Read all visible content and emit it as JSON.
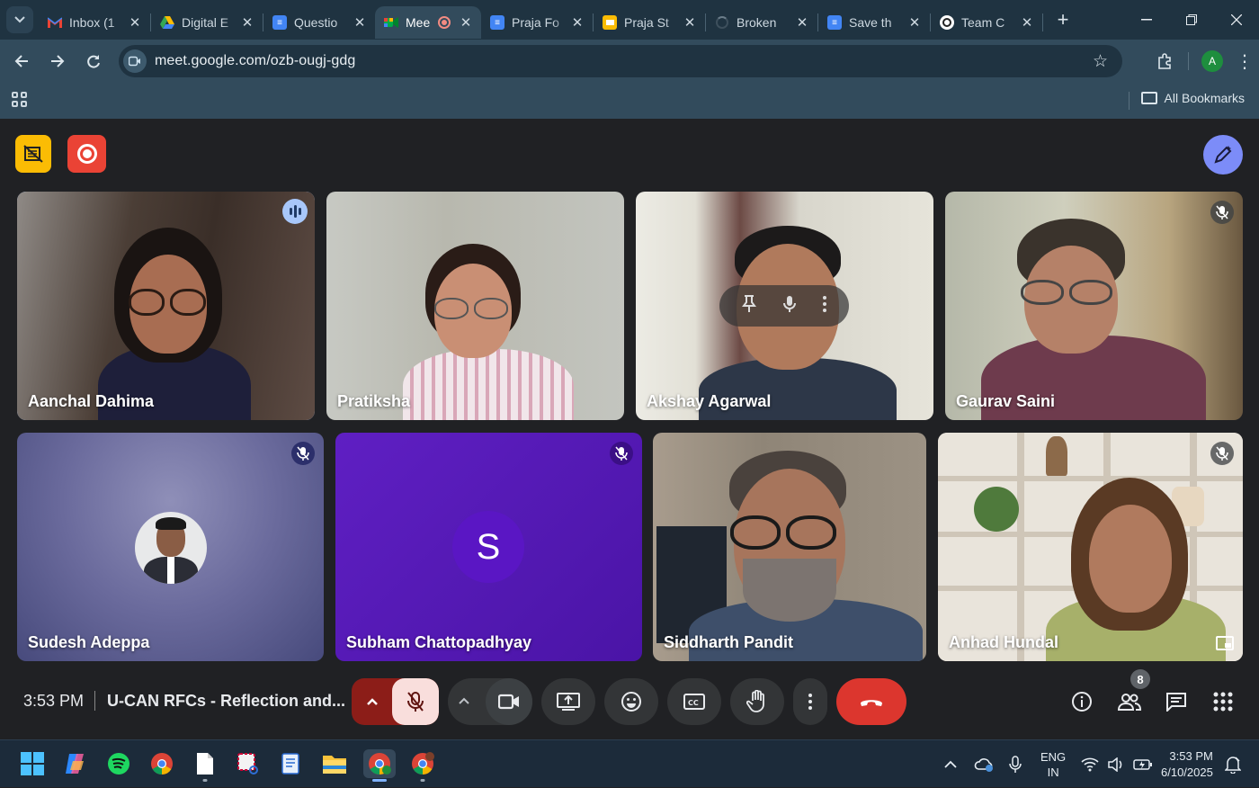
{
  "browser": {
    "tabs": [
      {
        "title": "Inbox (1",
        "favicon": "gmail-icon",
        "color": "#ea4335"
      },
      {
        "title": "Digital E",
        "favicon": "google-drive-icon",
        "color": "#34a853"
      },
      {
        "title": "Questio",
        "favicon": "google-docs-icon",
        "color": "#4285f4"
      },
      {
        "title": "Mee",
        "favicon": "google-meet-icon",
        "color": "#00ac47"
      },
      {
        "title": "Praja Fo",
        "favicon": "google-docs-icon",
        "color": "#4285f4"
      },
      {
        "title": "Praja St",
        "favicon": "google-slides-icon",
        "color": "#fbbc04"
      },
      {
        "title": "Broken",
        "favicon": "loading-icon",
        "color": "#2d3e4a"
      },
      {
        "title": "Save th",
        "favicon": "google-docs-icon",
        "color": "#4285f4"
      },
      {
        "title": "Team C",
        "favicon": "chatgpt-icon",
        "color": "#e8eaed"
      }
    ],
    "active_tab_index": 3,
    "url": "meet.google.com/ozb-ougj-gdg",
    "all_bookmarks_label": "All Bookmarks",
    "profile_initial": "A"
  },
  "meeting": {
    "time": "3:53 PM",
    "title": "U-CAN RFCs - Reflection and...",
    "participant_count": "8",
    "participants": [
      {
        "name": "Aanchal Dahima",
        "state": "speaking"
      },
      {
        "name": "Pratiksha",
        "state": "video"
      },
      {
        "name": "Akshay Agarwal",
        "state": "video-hover"
      },
      {
        "name": "Gaurav Saini",
        "state": "muted"
      },
      {
        "name": "Sudesh Adeppa",
        "state": "muted-avatar"
      },
      {
        "name": "Subham Chattopadhyay",
        "state": "muted-letter",
        "initial": "S"
      },
      {
        "name": "Siddharth Pandit",
        "state": "video"
      },
      {
        "name": "Anhad Hundal",
        "state": "muted-self-view"
      }
    ],
    "colors": {
      "end_call": "#dc362e",
      "mic_muted_bg": "#f9dedc",
      "speaking_outline": "#a8c7fa",
      "letter_avatar": "#5a16c4"
    }
  },
  "taskbar": {
    "apps": [
      "windows-start-icon",
      "copilot-icon",
      "spotify-icon",
      "chrome-icon",
      "file-icon",
      "snipping-tool-icon",
      "notepad-icon",
      "file-explorer-icon",
      "chrome-profile-icon",
      "chrome-profile-2-icon"
    ],
    "language": "ENG",
    "region": "IN",
    "clock_time": "3:53 PM",
    "clock_date": "6/10/2025"
  }
}
